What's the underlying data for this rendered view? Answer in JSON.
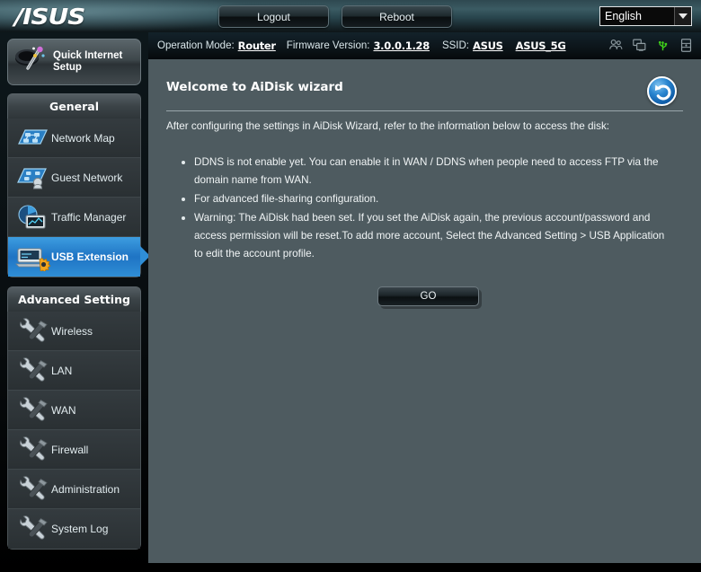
{
  "header": {
    "logo_text": "/ISUS",
    "logout_label": "Logout",
    "reboot_label": "Reboot",
    "language_value": "English",
    "language_icon": "chevron-down-icon"
  },
  "status_bar": {
    "operation_mode_label": "Operation Mode:",
    "operation_mode_value": "Router",
    "firmware_label": "Firmware Version:",
    "firmware_value": "3.0.0.1.28",
    "ssid_label": "SSID:",
    "ssid_value": "ASUS",
    "ssid_value_5g": "ASUS_5G",
    "icons": [
      "clients-icon",
      "network-devices-icon",
      "usb-icon",
      "printer-icon"
    ],
    "usb_icon_color": "#3fcf1a"
  },
  "sidebar": {
    "quick_setup": {
      "label": "Quick Internet Setup",
      "icon": "magic-wand-icon"
    },
    "groups": [
      {
        "title": "General",
        "items": [
          {
            "label": "Network Map",
            "icon": "network-map-icon",
            "active": false
          },
          {
            "label": "Guest Network",
            "icon": "guest-network-icon",
            "active": false
          },
          {
            "label": "Traffic Manager",
            "icon": "traffic-manager-icon",
            "active": false
          },
          {
            "label": "USB Extension",
            "icon": "usb-extension-icon",
            "active": true
          }
        ]
      },
      {
        "title": "Advanced Setting",
        "items": [
          {
            "label": "Wireless",
            "icon": "tools-icon",
            "active": false
          },
          {
            "label": "LAN",
            "icon": "tools-icon",
            "active": false
          },
          {
            "label": "WAN",
            "icon": "tools-icon",
            "active": false
          },
          {
            "label": "Firewall",
            "icon": "tools-icon",
            "active": false
          },
          {
            "label": "Administration",
            "icon": "tools-icon",
            "active": false
          },
          {
            "label": "System Log",
            "icon": "tools-icon",
            "active": false
          }
        ]
      }
    ]
  },
  "main": {
    "title": "Welcome to AiDisk wizard",
    "refresh_icon": "back-arrow-icon",
    "intro": "After configuring the settings in AiDisk Wizard, refer to the information below to access the disk:",
    "bullets": [
      "DDNS is not enable yet. You can enable it in WAN / DDNS when people need to access FTP via the domain name from WAN.",
      "For advanced file-sharing configuration.",
      "Warning: The AiDisk had been set. If you set the AiDisk again, the previous account/password and access permission will be reset.To add more account, Select the Advanced Setting > USB Application to edit the account profile."
    ],
    "go_label": "GO"
  },
  "colors": {
    "accent_blue": "#2f8ed6",
    "panel_bg": "#4e5b60",
    "usb_green": "#3fcf1a",
    "header_teal": "#3b5b63"
  }
}
